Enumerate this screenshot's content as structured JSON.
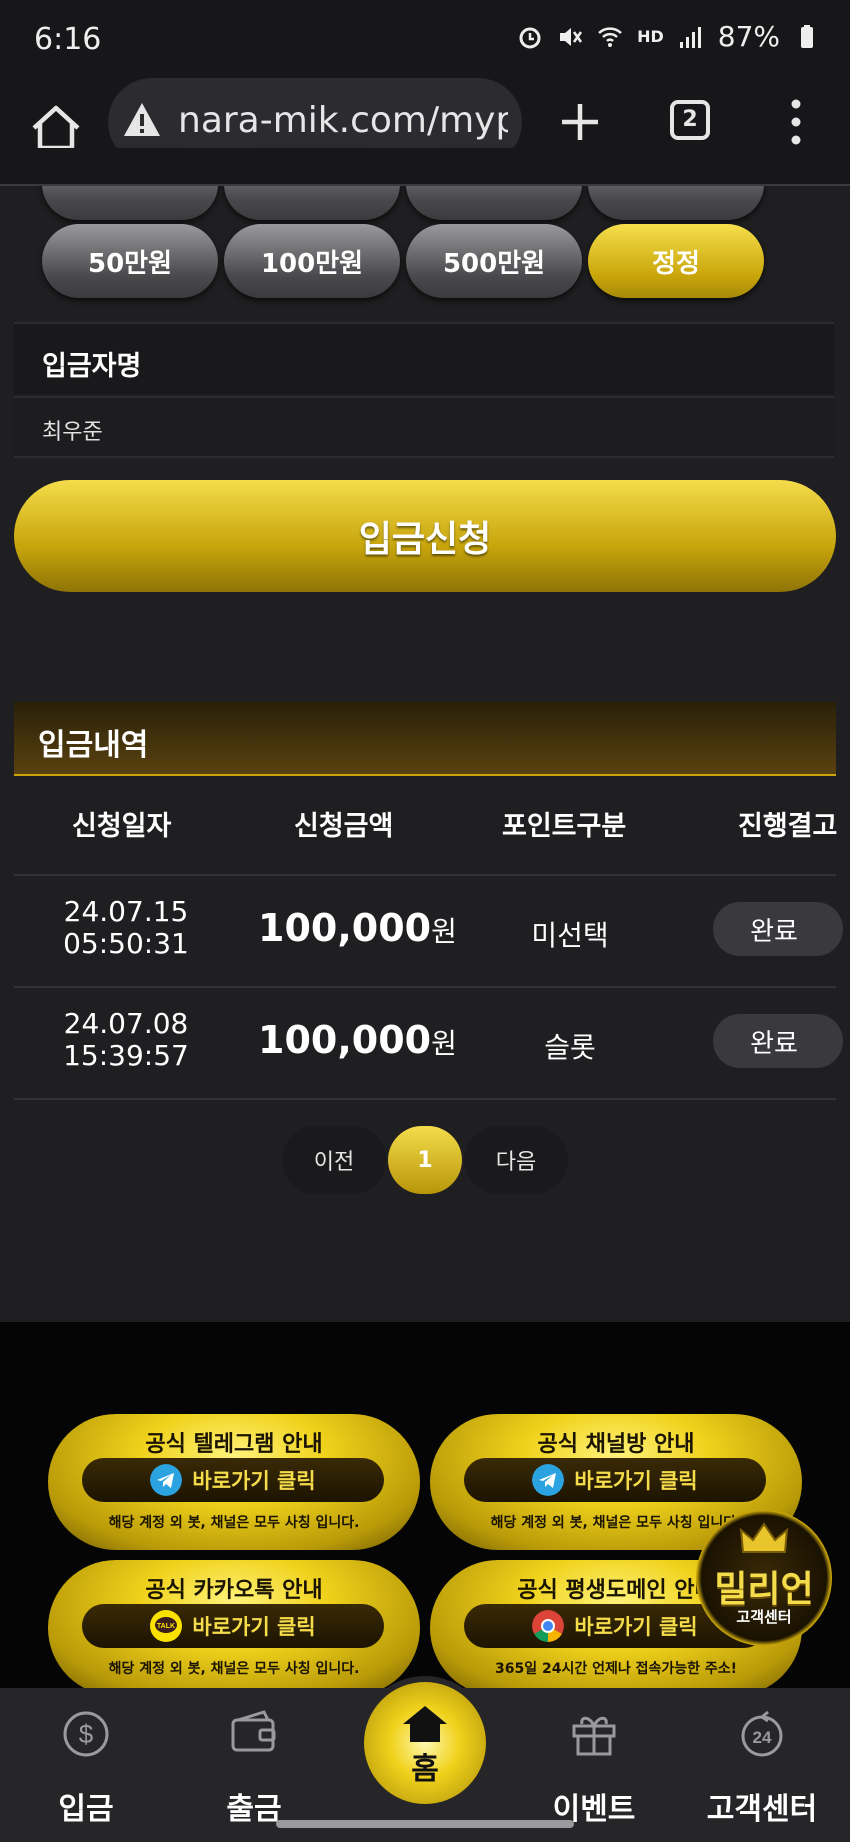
{
  "status_bar": {
    "time": "6:16",
    "hd_label": "HD",
    "battery": "87%"
  },
  "browser": {
    "url": "nara-mik.com/myp",
    "tab_count": "2"
  },
  "amount_buttons": [
    "50만원",
    "100만원",
    "500만원",
    "정정"
  ],
  "depositor": {
    "label": "입금자명",
    "value": "최우준"
  },
  "submit_label": "입금신청",
  "history": {
    "title": "입금내역",
    "columns": [
      "신청일자",
      "신청금액",
      "포인트구분",
      "진행결고"
    ],
    "rows": [
      {
        "date": "24.07.15",
        "time": "05:50:31",
        "amount": "100,000",
        "unit": "원",
        "type": "미선택",
        "status": "완료"
      },
      {
        "date": "24.07.08",
        "time": "15:39:57",
        "amount": "100,000",
        "unit": "원",
        "type": "슬롯",
        "status": "완료"
      }
    ]
  },
  "pagination": {
    "prev": "이전",
    "current": "1",
    "next": "다음"
  },
  "promos": [
    {
      "title": "공식 텔레그램 안내",
      "button": "바로가기 클릭",
      "note": "해당 계정 외 봇, 채널은 모두 사칭 입니다.",
      "icon": "telegram-icon"
    },
    {
      "title": "공식 채널방 안내",
      "button": "바로가기 클릭",
      "note": "해당 계정 외 봇, 채널은 모두 사칭 입니다.",
      "icon": "telegram-icon"
    },
    {
      "title": "공식 카카오톡 안내",
      "button": "바로가기 클릭",
      "note": "해당 계정 외 봇, 채널은 모두 사칭 입니다.",
      "icon": "kakaotalk-icon"
    },
    {
      "title": "공식 평생도메인 안내",
      "button": "바로가기 클릭",
      "note": "365일 24시간 언제나 접속가능한 주소!",
      "icon": "chrome-icon"
    }
  ],
  "badge": {
    "name": "밀리언",
    "sub": "고객센터"
  },
  "nav": {
    "deposit": "입금",
    "withdraw": "출금",
    "home": "홈",
    "event": "이벤트",
    "support": "고객센터"
  },
  "colors": {
    "gold": "#f0d21c",
    "background": "#1f1e20"
  }
}
